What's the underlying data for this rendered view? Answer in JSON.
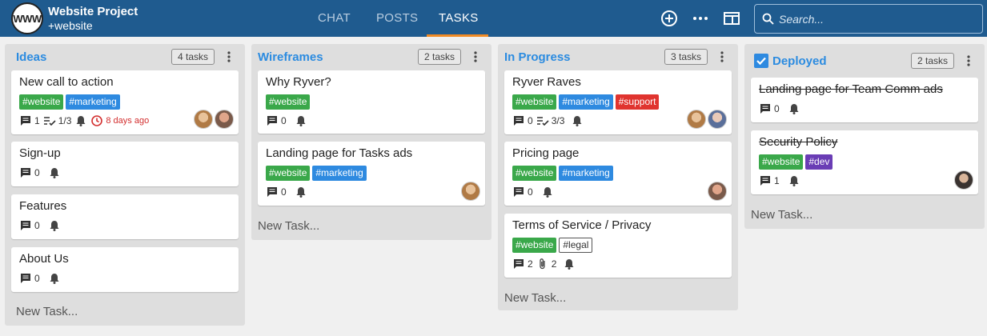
{
  "header": {
    "logo_text": "WWW",
    "project_title": "Website Project",
    "project_subtitle": "+website",
    "tabs": [
      {
        "label": "CHAT"
      },
      {
        "label": "POSTS"
      },
      {
        "label": "TASKS",
        "active": true
      }
    ],
    "search": {
      "placeholder": "Search...",
      "value": ""
    },
    "icons": [
      "add-circle-icon",
      "more-horizontal-icon",
      "panel-layout-icon"
    ]
  },
  "columns": [
    {
      "title": "Ideas",
      "count": "4 tasks",
      "new_task": "New Task...",
      "cards": [
        {
          "title": "New call to action",
          "tags": [
            "#website",
            "#marketing"
          ],
          "comments": "1",
          "checklist": "1/3",
          "due": "8 days ago",
          "avatars": 2
        },
        {
          "title": "Sign-up",
          "comments": "0"
        },
        {
          "title": "Features",
          "comments": "0"
        },
        {
          "title": "About Us",
          "comments": "0"
        }
      ]
    },
    {
      "title": "Wireframes",
      "count": "2 tasks",
      "new_task": "New Task...",
      "cards": [
        {
          "title": "Why Ryver?",
          "tags": [
            "#website"
          ],
          "comments": "0"
        },
        {
          "title": "Landing page for Tasks ads",
          "tags": [
            "#website",
            "#marketing"
          ],
          "comments": "0",
          "avatars": 1
        }
      ]
    },
    {
      "title": "In Progress",
      "count": "3 tasks",
      "new_task": "New Task...",
      "cards": [
        {
          "title": "Ryver Raves",
          "tags": [
            "#website",
            "#marketing",
            "#support"
          ],
          "comments": "0",
          "checklist": "3/3",
          "avatars": 2
        },
        {
          "title": "Pricing page",
          "tags": [
            "#website",
            "#marketing"
          ],
          "comments": "0",
          "avatars": 1
        },
        {
          "title": "Terms of Service / Privacy",
          "tags": [
            "#website",
            "#legal"
          ],
          "comments": "2",
          "attachments": "2"
        }
      ]
    },
    {
      "title": "Deployed",
      "count": "2 tasks",
      "new_task": "New Task...",
      "checked": true,
      "cards": [
        {
          "title": "Landing page for Team Comm ads",
          "comments": "0",
          "completed": true
        },
        {
          "title": "Security Policy",
          "tags": [
            "#website",
            "#dev"
          ],
          "comments": "1",
          "completed": true,
          "avatars": 1
        }
      ]
    }
  ],
  "colors": {
    "header_bg": "#1f5b8f",
    "active_tab_underline": "#f08a24",
    "column_title": "#2b8be0",
    "tag_website": "#3aa84a",
    "tag_marketing": "#2e8ae0",
    "tag_support": "#e0342f",
    "tag_dev": "#6a3db5"
  }
}
